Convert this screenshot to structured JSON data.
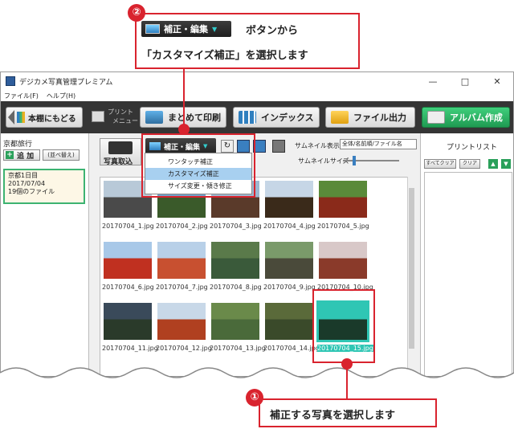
{
  "callout_top": {
    "number": "②",
    "button_label": "補正・編集",
    "text_line1": "ボタンから",
    "text_line2": "「カスタマイズ補正」を選択します"
  },
  "callout_bottom": {
    "number": "①",
    "text": "補正する写真を選択します"
  },
  "window": {
    "title": "デジカメ写真管理プレミアム",
    "menu": [
      "ファイル(F)",
      "ヘルプ(H)"
    ],
    "controls": {
      "minimize": "—",
      "maximize": "□",
      "close": "✕"
    }
  },
  "toolbar": {
    "back": "本棚にもどる",
    "print_menu_line1": "プリント",
    "print_menu_line2": "メニュー",
    "batch_print": "まとめて印刷",
    "index": "インデックス",
    "file_output": "ファイル出力",
    "album_create": "アルバム作成"
  },
  "left_panel": {
    "title": "京都旅行",
    "add_button": "追 加",
    "sort_button": "(並べ替え)",
    "album": {
      "name": "京都1日目",
      "date": "2017/07/04",
      "count": "19個のファイル"
    }
  },
  "center": {
    "import_label": "写真取込",
    "edit_button": "補正・編集",
    "dropdown": [
      "ワンタッチ補正",
      "カスタマイズ補正",
      "サイズ変更・傾き修正"
    ],
    "dropdown_selected_index": 1,
    "thumb_display_label": "サムネイル表示",
    "thumb_display_value": "全体/名前順/ファイル名",
    "thumb_size_label": "サムネイルサイズ",
    "photos": [
      "20170704_1.jpg",
      "20170704_2.jpg",
      "20170704_3.jpg",
      "20170704_4.jpg",
      "20170704_5.jpg",
      "20170704_6.jpg",
      "20170704_7.jpg",
      "20170704_8.jpg",
      "20170704_9.jpg",
      "20170704_10.jpg",
      "20170704_11.jpg",
      "20170704_12.jpg",
      "20170704_13.jpg",
      "20170704_14.jpg",
      "20170704_15.jpg"
    ],
    "selected_photo_index": 14
  },
  "right_panel": {
    "title": "プリントリスト",
    "clear_all": "すべてクリア",
    "clear": "クリア"
  },
  "colors": {
    "accent_red": "#d9232e",
    "selection_teal": "#2fc6b4",
    "album_green": "#3cb371"
  }
}
